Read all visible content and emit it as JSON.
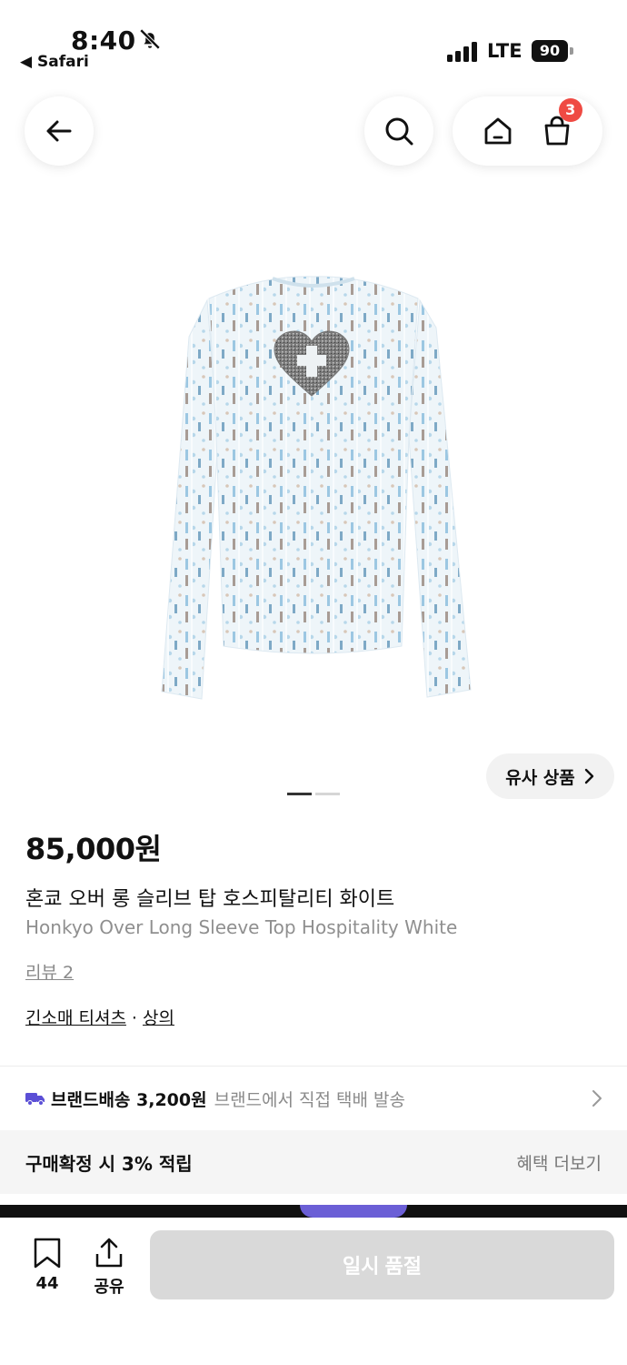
{
  "status_bar": {
    "time": "8:40",
    "back_app": "◀ Safari",
    "network": "LTE",
    "battery": "90"
  },
  "nav": {
    "back_icon": "arrow-left-icon",
    "search_icon": "search-icon",
    "home_icon": "home-icon",
    "cart_icon": "shopping-bag-icon",
    "cart_count": "3"
  },
  "product": {
    "image_icon": "long-sleeve-top-image",
    "similar_label": "유사 상품",
    "price": "85,000원",
    "title_ko": "혼쿄 오버 롱 슬리브 탑 호스피탈리티 화이트",
    "title_en": "Honkyo Over Long Sleeve Top Hospitality White",
    "review": "리뷰 2",
    "category_1": "긴소매 티셔츠",
    "category_sep": "·",
    "category_2": "상의",
    "carousel": {
      "current": 1,
      "total": 2
    }
  },
  "delivery": {
    "label": "브랜드배송 3,200원",
    "desc": "브랜드에서 직접 택배 발송"
  },
  "benefit": {
    "label": "구매확정 시 3% 적립",
    "more": "혜택 더보기"
  },
  "bottom_bar": {
    "bookmark_count": "44",
    "share_label": "공유",
    "buy_label": "일시 품절"
  },
  "colors": {
    "badge": "#ef4a43",
    "truck": "#5b4fd6",
    "disabled_button": "#d9d9d9"
  }
}
